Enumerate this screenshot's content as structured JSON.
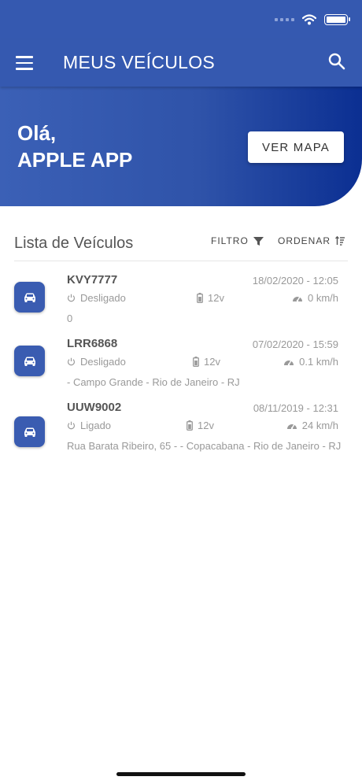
{
  "app": {
    "title": "MEUS VEÍCULOS",
    "colors": {
      "primary": "#3559b0",
      "hero_dark": "#0b2f92",
      "badge": "#3a5cb1"
    }
  },
  "hero": {
    "greeting_line1": "Olá,",
    "greeting_line2": "APPLE APP",
    "map_button": "VER MAPA"
  },
  "list": {
    "title": "Lista de Veículos",
    "filter_label": "FILTRO",
    "order_label": "ORDENAR"
  },
  "vehicles": [
    {
      "plate": "KVY7777",
      "datetime": "18/02/2020 - 12:05",
      "status": "Desligado",
      "voltage": "12v",
      "speed": "0 km/h",
      "address": "0"
    },
    {
      "plate": "LRR6868",
      "datetime": "07/02/2020 - 15:59",
      "status": "Desligado",
      "voltage": "12v",
      "speed": "0.1 km/h",
      "address": "- Campo Grande - Rio de Janeiro - RJ"
    },
    {
      "plate": "UUW9002",
      "datetime": "08/11/2019 - 12:31",
      "status": "Ligado",
      "voltage": "12v",
      "speed": "24 km/h",
      "address": "Rua Barata Ribeiro, 65 - - Copacabana - Rio de Janeiro - RJ"
    }
  ],
  "icons": [
    "menu-icon",
    "search-icon",
    "filter-icon",
    "sort-icon",
    "car-icon",
    "power-icon",
    "battery-icon",
    "speedometer-icon",
    "wifi-icon"
  ]
}
